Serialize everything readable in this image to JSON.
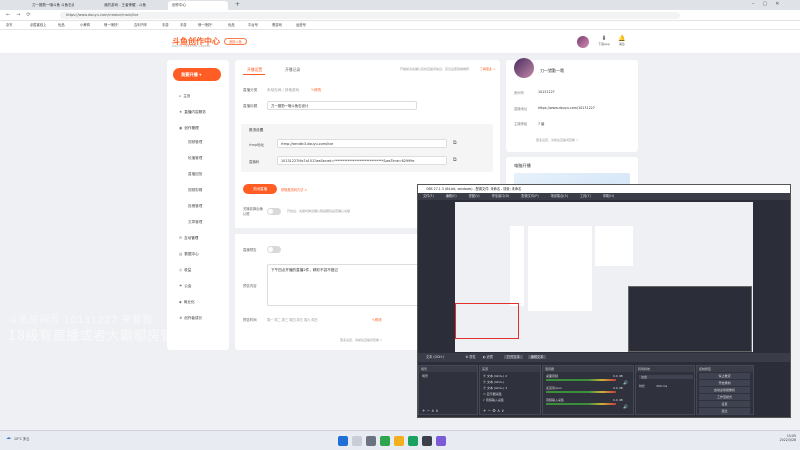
{
  "browser": {
    "tabs": [
      {
        "label": "刀一猎勤一哦斗鱼 斗鱼石设计"
      },
      {
        "label": "我的游戏 - 王者荣耀 - 斗鱼"
      },
      {
        "label": "创作中心"
      }
    ],
    "url": "https://www.douyu.com/creator/main/live",
    "bookmarks": [
      "京东",
      "必胜客线上",
      "优品",
      "小黄鸭",
      "喷一喷好！",
      "吉利汽车",
      "手游",
      "手游",
      "喷一喷好！",
      "优品",
      "平台号",
      "黑游戏",
      "运营号"
    ]
  },
  "site": {
    "logo": "斗鱼创作中心",
    "logo_sub": "DOUYU CREATOR CENTER",
    "creator_button": "返回斗鱼",
    "header_icons": [
      {
        "icon": "download-icon",
        "label": "下载App"
      },
      {
        "icon": "bell-icon",
        "label": "消息"
      }
    ]
  },
  "sidebar": {
    "live_button": "我要开播",
    "items": [
      {
        "label": "主页",
        "icon": "home-icon",
        "sub": false
      },
      {
        "label": "直播内容服务",
        "icon": "star-icon",
        "sub": false
      },
      {
        "label": "创作管理",
        "icon": "tv-icon",
        "sub": false
      },
      {
        "label": "视频管理",
        "sub": true
      },
      {
        "label": "轮播管理",
        "sub": true
      },
      {
        "label": "直播回放",
        "sub": true
      },
      {
        "label": "视频剪辑",
        "sub": true
      },
      {
        "label": "投稿管理",
        "sub": true
      },
      {
        "label": "文章管理",
        "sub": true
      },
      {
        "label": "互动管理",
        "icon": "chat-icon",
        "sub": false
      },
      {
        "label": "数据中心",
        "icon": "chart-icon",
        "sub": false
      },
      {
        "label": "收益",
        "icon": "coin-icon",
        "sub": false
      },
      {
        "label": "公会",
        "icon": "flag-icon",
        "sub": false
      },
      {
        "label": "商业化",
        "icon": "briefcase-icon",
        "sub": false
      },
      {
        "label": "创作者成长",
        "icon": "trophy-icon",
        "sub": false
      }
    ]
  },
  "main": {
    "tabs": [
      "开播设置",
      "开播记录"
    ],
    "tip": "开播前请先确认您的直播间信息，完善后更易被推荐",
    "tip_link": "了解更多 >",
    "category_label": "直播分类",
    "category_value": "永劫无间 / 其他游戏",
    "category_action": "修改",
    "title_label": "直播标题",
    "title_value": "刀一猎勤一哦斗鱼石设计",
    "push_header": "推流设置",
    "rtmp_label": "rtmp地址",
    "rtmp_value": "rtmp://sendtc3.douyu.com/live",
    "key_label": "直播码",
    "key_value": "10131227i9o7a151?wsSecret=*****************************&wsTime=62999e",
    "start_button": "关闭直播",
    "start_link": "获取推流码方法 >",
    "toggle1_label": "关播前弹出确认框",
    "toggle1_desc": "开启后，关播时弹出确认框提醒您是否确认关播",
    "toggle2_label": "直播预告",
    "notice_label": "预告内容",
    "notice_text": "下午四点开播的直播2件，精彩不容不错过",
    "notice_time_label": "预告时间",
    "notice_time_items": [
      "周一 周二 周三 周四 周五 周六 周日"
    ],
    "notice_time_action": "修改",
    "footer_link": "更多设置，请前往直播间查看 >"
  },
  "right": {
    "name": "刀一猎勤一哦",
    "room_label": "房间号",
    "room_value": "10131227",
    "url_label": "直播地址",
    "url_value": "https://www.douyu.com/10131227",
    "followers_label": "主播等级",
    "followers_value": "7 级",
    "more_link": "更多设置，请前往直播间查看 >",
    "card2_title": "电脑开播"
  },
  "watermark": {
    "line1": "斗鱼房间号 10131227 来看我",
    "line2": "18级有直播或者大霸都房管"
  },
  "obs": {
    "title": "OBS 27.1.3 (64-bit, windows) - 配置文件: 未命名 - 场景: 未命名",
    "menu": [
      "文件(F)",
      "编辑(E)",
      "视图(V)",
      "停靠窗口(D)",
      "配置文件(P)",
      "场景集合(S)",
      "工具(T)",
      "帮助(H)"
    ],
    "source_bar": [
      "文本 (GDI+)",
      "属性",
      "滤镜",
      "打开文本",
      "编辑文本"
    ],
    "panels": [
      "场景",
      "来源",
      "混音器",
      "转场特效",
      "控制按钮"
    ],
    "scene": "场景",
    "sources": [
      "文本 (GDI+) 2",
      "文本 (GDI+)",
      "文本 (GDI+) 3",
      "显示器采集",
      "音频输入采集"
    ],
    "mixer": [
      "桌面音频",
      "麦克风/Aux",
      "音频输入采集"
    ],
    "mixer_db": [
      "0.0 dB",
      "0.0 dB",
      "0.0 dB"
    ],
    "transition": "淡出",
    "duration_label": "时长",
    "duration": "300 ms",
    "controls": [
      "停止推流",
      "开始录制",
      "启动虚拟摄像机",
      "工作室模式",
      "设置",
      "退出"
    ]
  },
  "taskbar": {
    "weather": "10°C 多云",
    "time": "15:05",
    "date": "2022/3/28"
  }
}
